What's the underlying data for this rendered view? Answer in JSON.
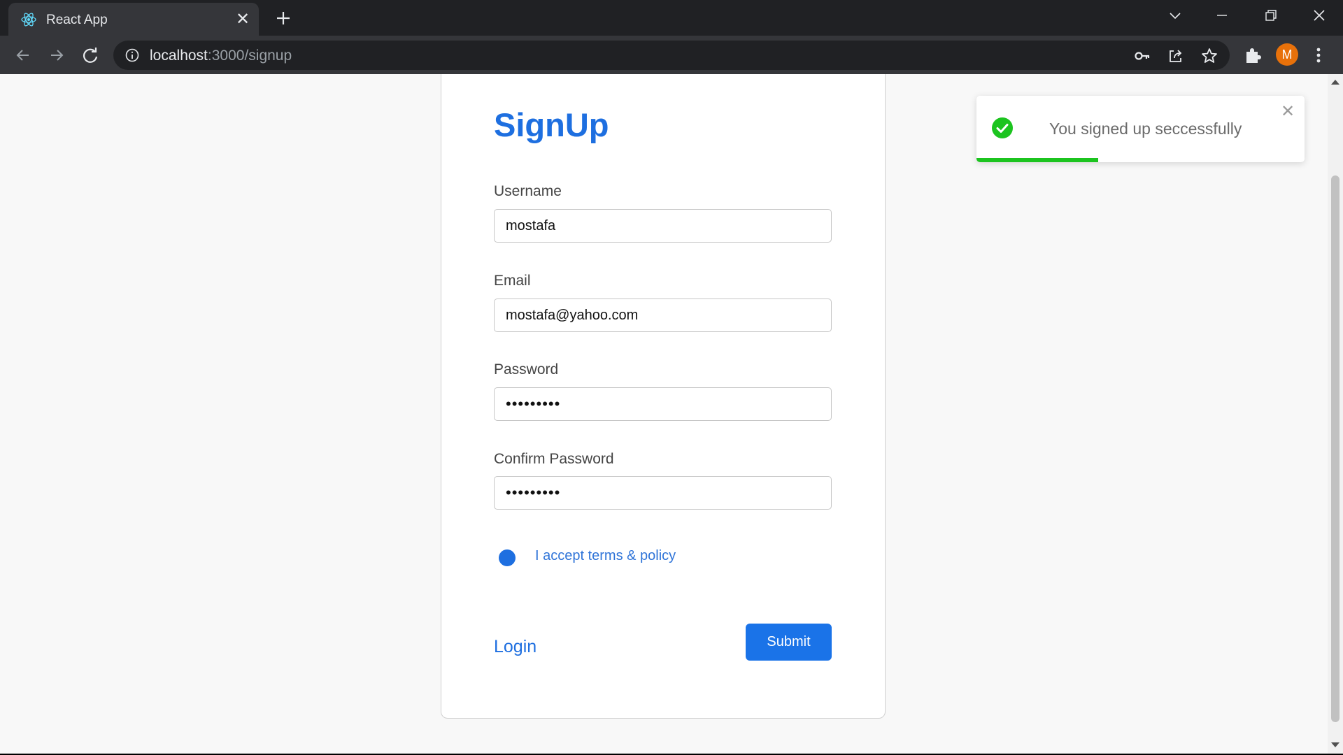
{
  "browser": {
    "tab_title": "React App",
    "tab_favicon": "react-logo-icon",
    "url_host": "localhost",
    "url_rest": ":3000/signup",
    "avatar_initial": "M",
    "avatar_color": "#e8710a"
  },
  "page": {
    "title": "SignUp",
    "fields": {
      "username": {
        "label": "Username",
        "value": "mostafa"
      },
      "email": {
        "label": "Email",
        "value": "mostafa@yahoo.com"
      },
      "password": {
        "label": "Password",
        "value": "•••••••••"
      },
      "confirm_password": {
        "label": "Confirm Password",
        "value": "•••••••••"
      }
    },
    "terms_label": "I accept terms & policy",
    "terms_checked": true,
    "login_link": "Login",
    "submit_label": "Submit",
    "accent_color": "#1a73e8"
  },
  "toast": {
    "message": "You signed up seccessfully",
    "icon": "success-check-icon",
    "status_color": "#1cc41f",
    "progress_fraction": 0.37
  }
}
